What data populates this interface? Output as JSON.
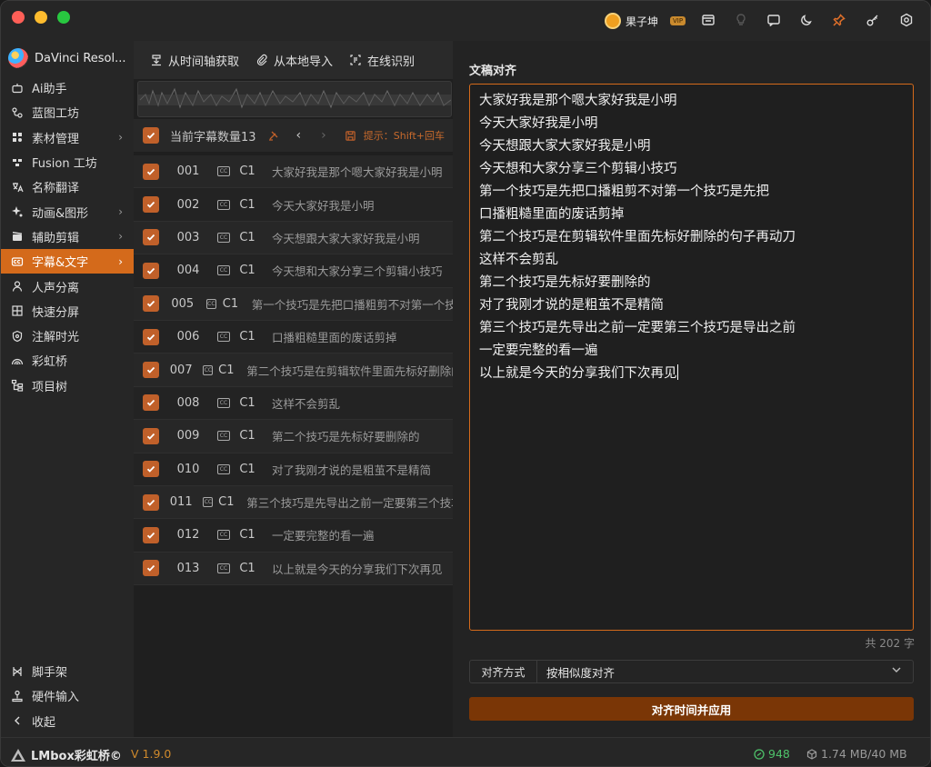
{
  "titlebar": {
    "user_name": "果子坤",
    "vip_badge": "VIP",
    "icons": [
      "store-icon",
      "lightbulb-icon",
      "message-icon",
      "moon-icon",
      "pin-icon",
      "key-icon",
      "settings-icon"
    ]
  },
  "sidebar": {
    "app_title": "DaVinci Resol...",
    "items": [
      {
        "label": "Ai助手",
        "icon": "robot-icon",
        "chevron": ""
      },
      {
        "label": "蓝图工坊",
        "icon": "blueprint-icon",
        "chevron": ""
      },
      {
        "label": "素材管理",
        "icon": "grid-icon",
        "chevron": "›"
      },
      {
        "label": "Fusion 工坊",
        "icon": "fusion-icon",
        "chevron": ""
      },
      {
        "label": "名称翻译",
        "icon": "translate-icon",
        "chevron": ""
      },
      {
        "label": "动画&图形",
        "icon": "sparkle-icon",
        "chevron": "›"
      },
      {
        "label": "辅助剪辑",
        "icon": "clapper-icon",
        "chevron": "›"
      },
      {
        "label": "字幕&文字",
        "icon": "cc-icon",
        "chevron": "›",
        "active": true
      },
      {
        "label": "人声分离",
        "icon": "person-icon",
        "chevron": ""
      },
      {
        "label": "快速分屏",
        "icon": "split-icon",
        "chevron": ""
      },
      {
        "label": "注解时光",
        "icon": "shield-icon",
        "chevron": ""
      },
      {
        "label": "彩虹桥",
        "icon": "rainbow-icon",
        "chevron": ""
      },
      {
        "label": "项目树",
        "icon": "tree-icon",
        "chevron": ""
      }
    ],
    "bottom_items": [
      {
        "label": "脚手架",
        "icon": "scaffold-icon"
      },
      {
        "label": "硬件输入",
        "icon": "joystick-icon"
      },
      {
        "label": "收起",
        "icon": "collapse-icon"
      }
    ]
  },
  "middle": {
    "toolbar": {
      "from_timeline": "从时间轴获取",
      "from_local": "从本地导入",
      "online_recognize": "在线识别"
    },
    "header": {
      "count_label": "当前字幕数量13",
      "hint": "提示：Shift+回车"
    },
    "rows": [
      {
        "num": "001",
        "track": "C1",
        "text": "大家好我是那个嗯大家好我是小明"
      },
      {
        "num": "002",
        "track": "C1",
        "text": "今天大家好我是小明"
      },
      {
        "num": "003",
        "track": "C1",
        "text": "今天想跟大家大家好我是小明"
      },
      {
        "num": "004",
        "track": "C1",
        "text": "今天想和大家分享三个剪辑小技巧"
      },
      {
        "num": "005",
        "track": "C1",
        "text": "第一个技巧是先把口播粗剪不对第一个技巧是先把"
      },
      {
        "num": "006",
        "track": "C1",
        "text": "口播粗糙里面的废话剪掉"
      },
      {
        "num": "007",
        "track": "C1",
        "text": "第二个技巧是在剪辑软件里面先标好删除的句子再动刀"
      },
      {
        "num": "008",
        "track": "C1",
        "text": "这样不会剪乱"
      },
      {
        "num": "009",
        "track": "C1",
        "text": "第二个技巧是先标好要删除的"
      },
      {
        "num": "010",
        "track": "C1",
        "text": "对了我刚才说的是粗茧不是精简"
      },
      {
        "num": "011",
        "track": "C1",
        "text": "第三个技巧是先导出之前一定要第三个技巧是导出之前"
      },
      {
        "num": "012",
        "track": "C1",
        "text": "一定要完整的看一遍"
      },
      {
        "num": "013",
        "track": "C1",
        "text": "以上就是今天的分享我们下次再见"
      }
    ]
  },
  "right": {
    "title": "文稿对齐",
    "lines": [
      "大家好我是那个嗯大家好我是小明",
      "今天大家好我是小明",
      "今天想跟大家大家好我是小明",
      "今天想和大家分享三个剪辑小技巧",
      "第一个技巧是先把口播粗剪不对第一个技巧是先把",
      "口播粗糙里面的废话剪掉",
      "第二个技巧是在剪辑软件里面先标好删除的句子再动刀",
      "这样不会剪乱",
      "第二个技巧是先标好要删除的",
      "对了我刚才说的是粗茧不是精简",
      "第三个技巧是先导出之前一定要第三个技巧是导出之前",
      "一定要完整的看一遍",
      "以上就是今天的分享我们下次再见"
    ],
    "char_count": "共 202 字",
    "align_label": "对齐方式",
    "align_value": "按相似度对齐",
    "apply_button": "对齐时间并应用"
  },
  "footer": {
    "brand": "LMbox彩虹桥©",
    "version": "V 1.9.0",
    "credits": "948",
    "storage": "1.74 MB/40 MB"
  },
  "colors": {
    "accent": "#d46a1b",
    "apply_button": "#7a3606",
    "checkbox": "#c0602a",
    "credit_green": "#4ec26a",
    "version_orange": "#d08a2c"
  }
}
